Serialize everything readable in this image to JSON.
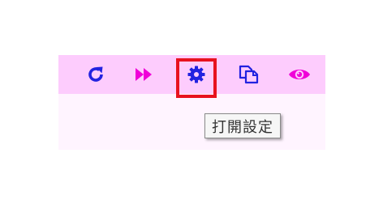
{
  "toolbar": {
    "buttons": [
      {
        "icon": "refresh-icon",
        "color": "#2222e0"
      },
      {
        "icon": "fast-forward-icon",
        "color": "#f000d8"
      },
      {
        "icon": "gear-icon",
        "color": "#2222e0"
      },
      {
        "icon": "copy-icon",
        "color": "#2222e0"
      },
      {
        "icon": "eye-icon",
        "color": "#f000d8"
      }
    ],
    "background_color": "#fdccfd"
  },
  "panel": {
    "background_color": "#fff4ff"
  },
  "highlight": {
    "target": "settings-button",
    "color": "#e8121f"
  },
  "tooltip": {
    "text": "打開設定"
  }
}
